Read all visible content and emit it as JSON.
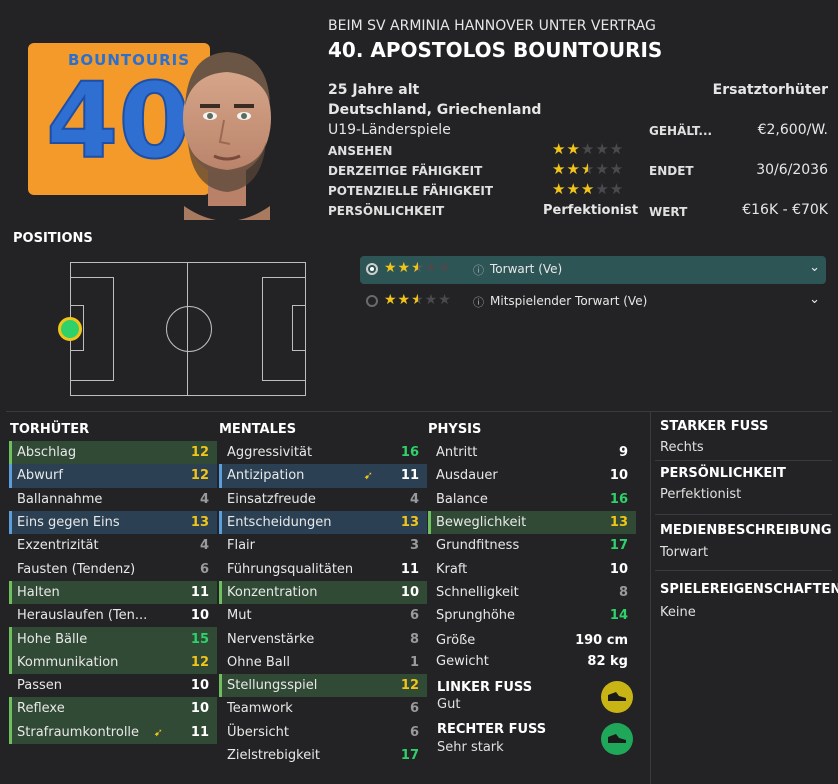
{
  "header": {
    "contract_line": "BEIM SV ARMINIA HANNOVER UNTER VERTRAG",
    "player_title": "40. APOSTOLOS BOUNTOURIS"
  },
  "shirt": {
    "name": "BOUNTOURIS",
    "number": "40",
    "color": "#f39a2a",
    "text_color": "#2f6fd1"
  },
  "info": {
    "age": "25 Jahre alt",
    "nationality": "Deutschland, Griechenland",
    "youth_caps": "U19-Länderspiele",
    "role": "Ersatztorhüter",
    "rows": [
      {
        "label": "ANSEHEN",
        "stars": 2
      },
      {
        "label": "DERZEITIGE FÄHIGKEIT",
        "stars": 2.5
      },
      {
        "label": "POTENZIELLE FÄHIGKEIT",
        "stars": 3
      },
      {
        "label": "PERSÖNLICHKEIT",
        "text": "Perfektionist"
      }
    ],
    "contract": [
      {
        "label": "GEHÄLT...",
        "value": "€2,600/W."
      },
      {
        "label": "ENDET",
        "value": "30/6/2036"
      },
      {
        "label": "WERT",
        "value": "€16K - €70K"
      }
    ]
  },
  "positions": {
    "title": "POSITIONS",
    "roles": [
      {
        "name": "Torwart (Ve)",
        "stars": 2.5,
        "selected": true
      },
      {
        "name": "Mitspielender Torwart (Ve)",
        "stars": 2.5,
        "selected": false
      }
    ]
  },
  "attributes": {
    "goalkeeping": {
      "title": "TORHÜTER",
      "items": [
        {
          "name": "Abschlag",
          "value": "12",
          "hl": "green",
          "color": "yellow"
        },
        {
          "name": "Abwurf",
          "value": "12",
          "hl": "blue",
          "color": "yellow"
        },
        {
          "name": "Ballannahme",
          "value": "4",
          "hl": "",
          "color": "grey"
        },
        {
          "name": "Eins gegen Eins",
          "value": "13",
          "hl": "blue",
          "color": "yellow"
        },
        {
          "name": "Exzentrizität",
          "value": "4",
          "hl": "",
          "color": "grey"
        },
        {
          "name": "Fausten (Tendenz)",
          "value": "6",
          "hl": "",
          "color": "grey"
        },
        {
          "name": "Halten",
          "value": "11",
          "hl": "green",
          "color": "white"
        },
        {
          "name": "Herauslaufen (Ten...",
          "value": "10",
          "hl": "",
          "color": "white"
        },
        {
          "name": "Hohe Bälle",
          "value": "15",
          "hl": "green",
          "color": "green"
        },
        {
          "name": "Kommunikation",
          "value": "12",
          "hl": "green",
          "color": "yellow"
        },
        {
          "name": "Passen",
          "value": "10",
          "hl": "",
          "color": "white"
        },
        {
          "name": "Reflexe",
          "value": "10",
          "hl": "green",
          "color": "white"
        },
        {
          "name": "Strafraumkontrolle",
          "value": "11",
          "hl": "green",
          "color": "white",
          "arrow": true
        }
      ]
    },
    "mental": {
      "title": "MENTALES",
      "items": [
        {
          "name": "Aggressivität",
          "value": "16",
          "hl": "",
          "color": "green"
        },
        {
          "name": "Antizipation",
          "value": "11",
          "hl": "blue",
          "color": "white",
          "arrow": true
        },
        {
          "name": "Einsatzfreude",
          "value": "4",
          "hl": "",
          "color": "grey"
        },
        {
          "name": "Entscheidungen",
          "value": "13",
          "hl": "blue",
          "color": "yellow"
        },
        {
          "name": "Flair",
          "value": "3",
          "hl": "",
          "color": "grey"
        },
        {
          "name": "Führungsqualitäten",
          "value": "11",
          "hl": "",
          "color": "white"
        },
        {
          "name": "Konzentration",
          "value": "10",
          "hl": "green",
          "color": "white"
        },
        {
          "name": "Mut",
          "value": "6",
          "hl": "",
          "color": "grey"
        },
        {
          "name": "Nervenstärke",
          "value": "8",
          "hl": "",
          "color": "grey"
        },
        {
          "name": "Ohne Ball",
          "value": "1",
          "hl": "",
          "color": "grey"
        },
        {
          "name": "Stellungsspiel",
          "value": "12",
          "hl": "green",
          "color": "yellow"
        },
        {
          "name": "Teamwork",
          "value": "6",
          "hl": "",
          "color": "grey"
        },
        {
          "name": "Übersicht",
          "value": "6",
          "hl": "",
          "color": "grey"
        },
        {
          "name": "Zielstrebigkeit",
          "value": "17",
          "hl": "",
          "color": "green"
        }
      ]
    },
    "physical": {
      "title": "PHYSIS",
      "items": [
        {
          "name": "Antritt",
          "value": "9",
          "hl": "",
          "color": "white"
        },
        {
          "name": "Ausdauer",
          "value": "10",
          "hl": "",
          "color": "white"
        },
        {
          "name": "Balance",
          "value": "16",
          "hl": "",
          "color": "green"
        },
        {
          "name": "Beweglichkeit",
          "value": "13",
          "hl": "green",
          "color": "yellow"
        },
        {
          "name": "Grundfitness",
          "value": "17",
          "hl": "",
          "color": "green"
        },
        {
          "name": "Kraft",
          "value": "10",
          "hl": "",
          "color": "white"
        },
        {
          "name": "Schnelligkeit",
          "value": "8",
          "hl": "",
          "color": "grey"
        },
        {
          "name": "Sprunghöhe",
          "value": "14",
          "hl": "",
          "color": "green"
        }
      ],
      "size": [
        {
          "name": "Größe",
          "value": "190 cm"
        },
        {
          "name": "Gewicht",
          "value": "82 kg"
        }
      ],
      "left_foot": {
        "title": "LINKER FUSS",
        "value": "Gut",
        "color": "#c9b416"
      },
      "right_foot": {
        "title": "RECHTER FUSS",
        "value": "Sehr stark",
        "color": "#1fa85a"
      }
    }
  },
  "side": [
    {
      "title": "STARKER FUSS",
      "value": "Rechts"
    },
    {
      "title": "PERSÖNLICHKEIT",
      "value": "Perfektionist"
    },
    {
      "title": "MEDIENBESCHREIBUNG",
      "value": "Torwart"
    },
    {
      "title": "SPIELEREIGENSCHAFTEN",
      "value": "Keine"
    }
  ]
}
